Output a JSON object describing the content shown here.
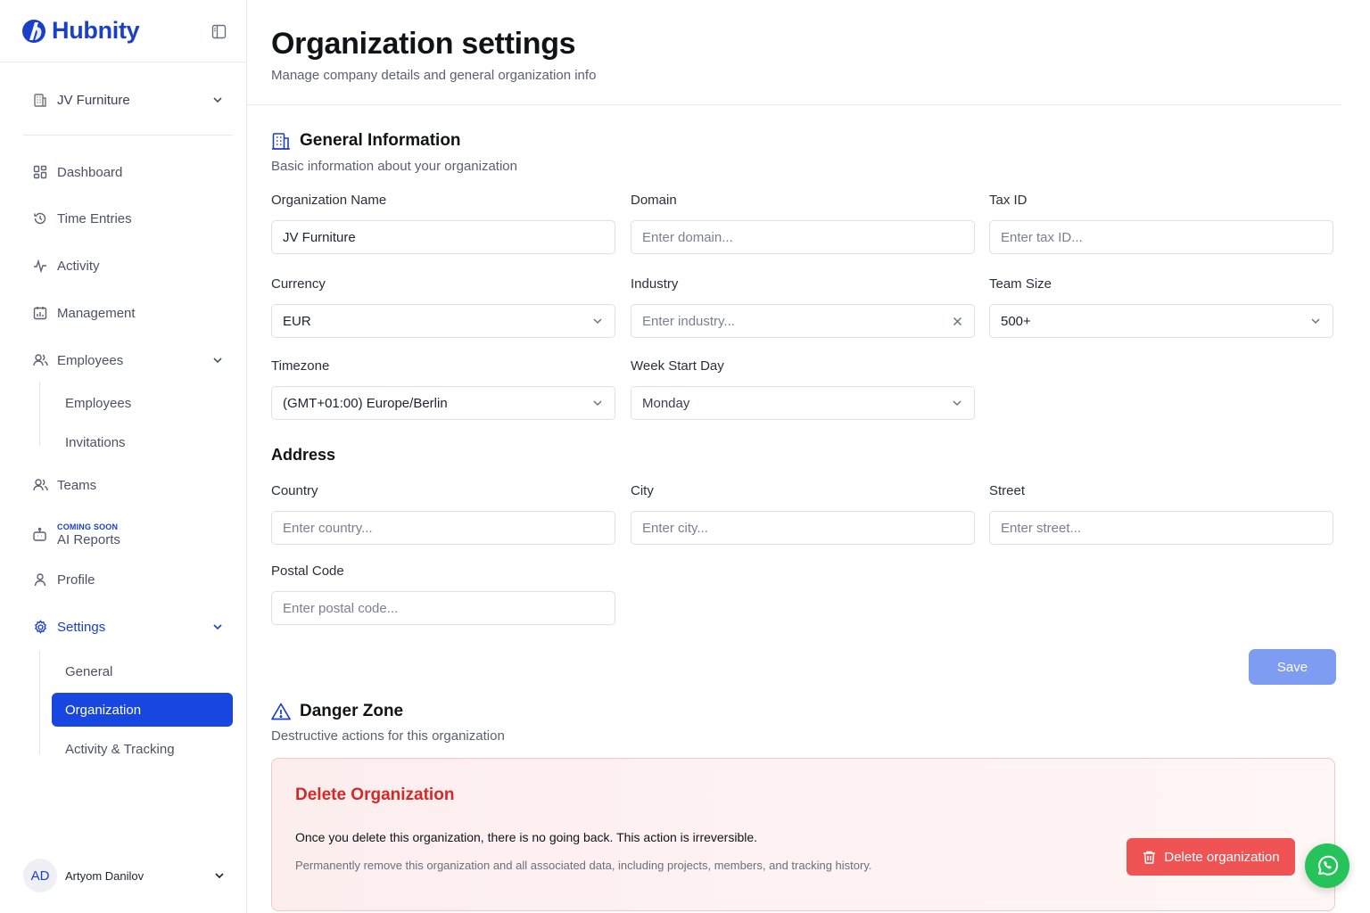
{
  "brand": {
    "name": "Hubnity",
    "color": "#1a3fc9"
  },
  "org_switcher": {
    "label": "JV Furniture"
  },
  "nav": {
    "dashboard": "Dashboard",
    "time_entries": "Time Entries",
    "activity": "Activity",
    "management": "Management",
    "employees": "Employees",
    "employees_sub": [
      "Employees",
      "Invitations"
    ],
    "teams": "Teams",
    "ai_reports": {
      "badge": "COMING SOON",
      "label": "AI Reports"
    },
    "profile": "Profile",
    "settings": "Settings",
    "settings_sub": [
      "General",
      "Organization",
      "Activity & Tracking"
    ]
  },
  "user": {
    "initials": "AD",
    "name": "Artyom Danilov"
  },
  "page": {
    "title": "Organization settings",
    "subtitle": "Manage company details and general organization info"
  },
  "general": {
    "title": "General Information",
    "subtitle": "Basic information about your organization",
    "org_name": {
      "label": "Organization Name",
      "value": "JV Furniture"
    },
    "domain": {
      "label": "Domain",
      "placeholder": "Enter domain..."
    },
    "tax_id": {
      "label": "Tax ID",
      "placeholder": "Enter tax ID..."
    },
    "currency": {
      "label": "Currency",
      "value": "EUR"
    },
    "industry": {
      "label": "Industry",
      "placeholder": "Enter industry..."
    },
    "team_size": {
      "label": "Team Size",
      "value": "500+"
    },
    "timezone": {
      "label": "Timezone",
      "value": "(GMT+01:00) Europe/Berlin"
    },
    "week_start": {
      "label": "Week Start Day",
      "value": "Monday"
    }
  },
  "address": {
    "title": "Address",
    "country": {
      "label": "Country",
      "placeholder": "Enter country..."
    },
    "city": {
      "label": "City",
      "placeholder": "Enter city..."
    },
    "street": {
      "label": "Street",
      "placeholder": "Enter street..."
    },
    "postal": {
      "label": "Postal Code",
      "placeholder": "Enter postal code..."
    }
  },
  "save_label": "Save",
  "danger": {
    "title": "Danger Zone",
    "subtitle": "Destructive actions for this organization",
    "box_title": "Delete Organization",
    "warning": "Once you delete this organization, there is no going back. This action is irreversible.",
    "description": "Permanently remove this organization and all associated data, including projects, members, and tracking history.",
    "button": "Delete organization",
    "color": "#d42929"
  }
}
